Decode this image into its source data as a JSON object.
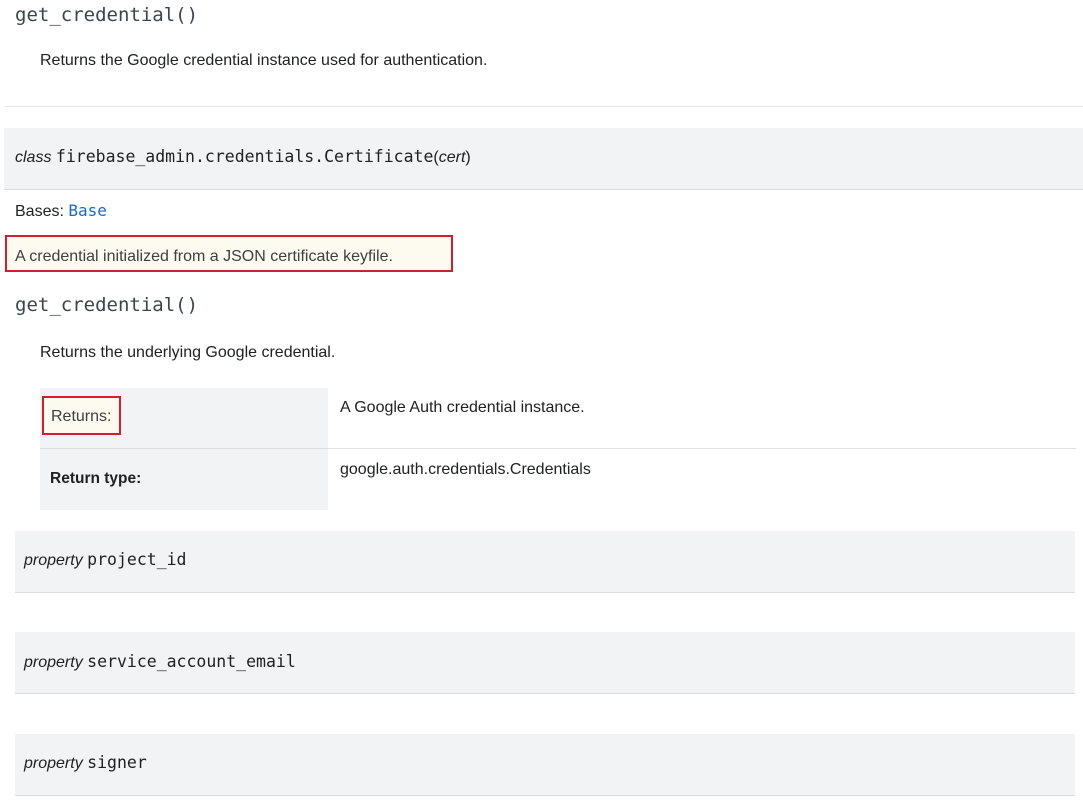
{
  "method1": {
    "signature": "get_credential()",
    "description": "Returns the Google credential instance used for authentication."
  },
  "class_sig": {
    "keyword": "class",
    "name": "firebase_admin.credentials.Certificate",
    "open": "(",
    "param": "cert",
    "close": ")"
  },
  "bases": {
    "label": "Bases:",
    "link": "Base"
  },
  "class_description": "A credential initialized from a JSON certificate keyfile.",
  "method2": {
    "signature": "get_credential()",
    "description": "Returns the underlying Google credential.",
    "fields": [
      {
        "label": "Returns:",
        "value": "A Google Auth credential instance."
      },
      {
        "label": "Return type:",
        "value": "google.auth.credentials.Credentials"
      }
    ]
  },
  "properties": [
    {
      "keyword": "property",
      "name": "project_id"
    },
    {
      "keyword": "property",
      "name": "service_account_email"
    },
    {
      "keyword": "property",
      "name": "signer"
    }
  ],
  "colors": {
    "highlight_border": "#d0202a",
    "link": "#1967d2",
    "signature_bg": "#f1f3f4"
  }
}
